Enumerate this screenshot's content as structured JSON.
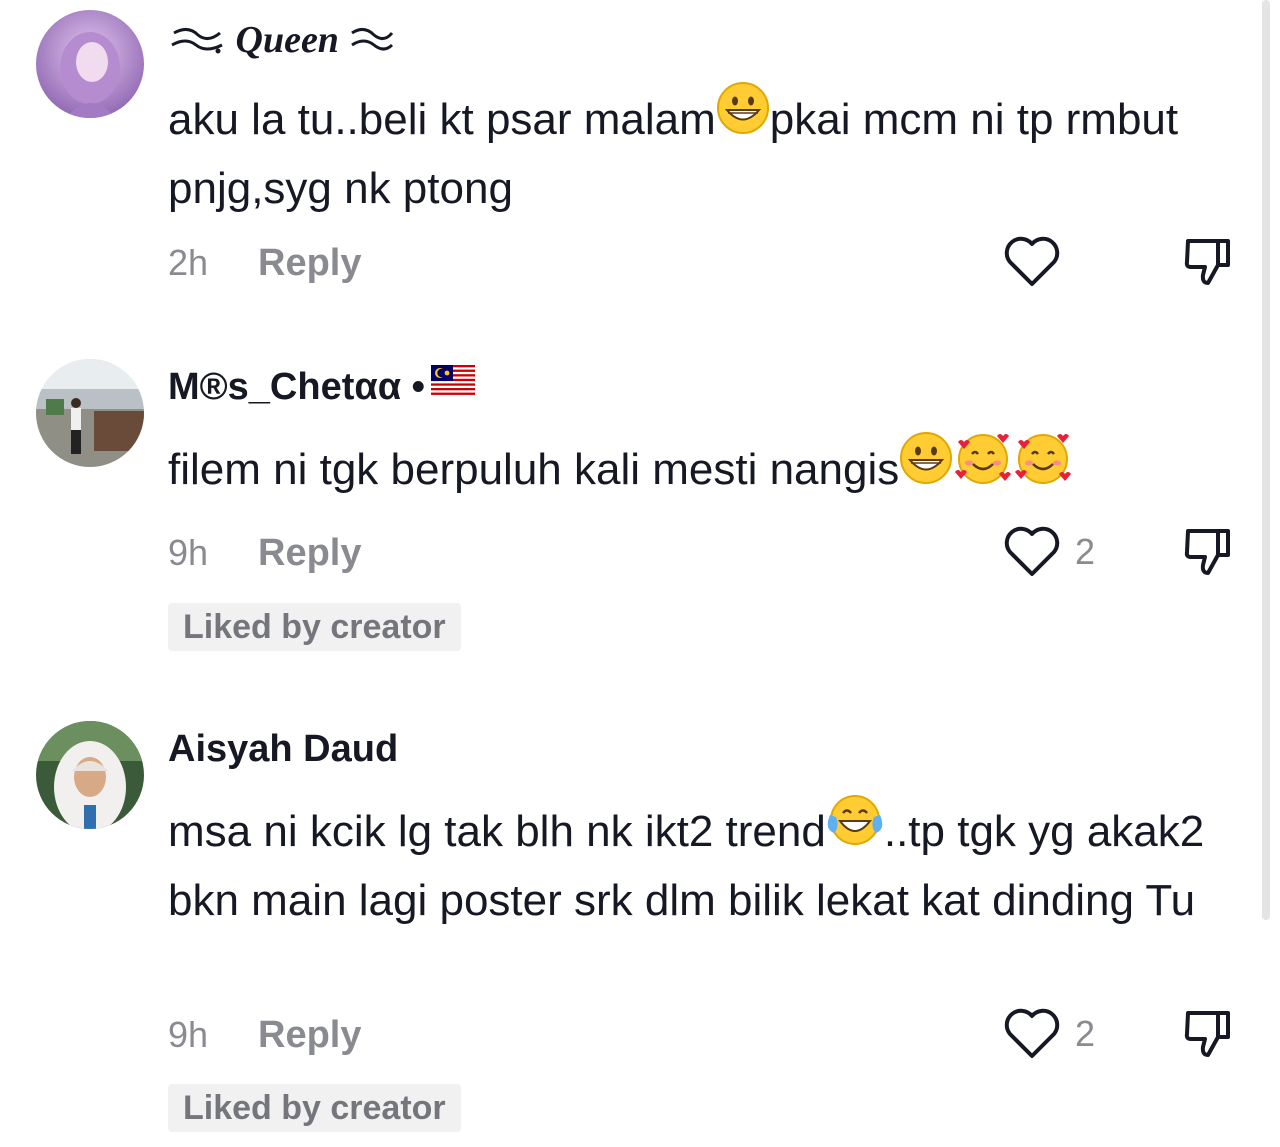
{
  "comments": [
    {
      "username": "Queen",
      "avatar": "avatar-woman-hijab-purple",
      "text_parts": [
        "aku la tu..beli kt psar malam",
        "pkai mcm ni tp rmbut pnjg,syg nk ptong"
      ],
      "emoji": [
        "grinning-face"
      ],
      "time": "2h",
      "reply_label": "Reply",
      "likes": ""
    },
    {
      "username": "M®s_Chetαα •",
      "avatar": "avatar-person-outdoors",
      "flag": "malaysia-flag-icon",
      "text_parts": [
        "filem ni tgk berpuluh kali mesti nangis"
      ],
      "emoji": [
        "grinning-face",
        "smiling-face-with-hearts",
        "smiling-face-with-hearts"
      ],
      "time": "9h",
      "reply_label": "Reply",
      "likes": "2",
      "badge": "Liked by creator"
    },
    {
      "username": "Aisyah Daud",
      "avatar": "avatar-woman-hijab-white",
      "text_parts": [
        "msa ni kcik lg tak blh nk ikt2 trend",
        "..tp tgk yg akak2 bkn main lagi poster srk dlm bilik lekat kat dinding Tu"
      ],
      "emoji": [
        "face-with-tears-of-joy"
      ],
      "time": "9h",
      "reply_label": "Reply",
      "likes": "2",
      "badge": "Liked by creator"
    }
  ],
  "colors": {
    "text": "#161823",
    "muted": "#8a8b91",
    "badge_bg": "#f1f1f2"
  }
}
